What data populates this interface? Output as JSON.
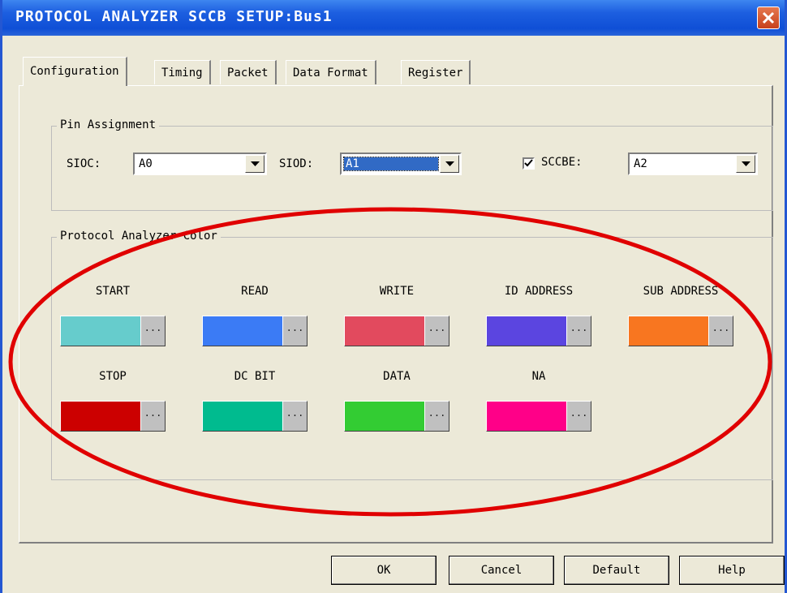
{
  "window": {
    "title": "PROTOCOL ANALYZER SCCB SETUP:Bus1"
  },
  "tabs": [
    {
      "label": "Configuration",
      "active": true
    },
    {
      "label": "Timing"
    },
    {
      "label": "Packet"
    },
    {
      "label": "Data Format"
    },
    {
      "label": "Register"
    }
  ],
  "pin_assignment": {
    "title": "Pin Assignment",
    "sioc": {
      "label": "SIOC:",
      "value": "A0"
    },
    "siod": {
      "label": "SIOD:",
      "value": "A1"
    },
    "sccbe": {
      "label": "SCCBE:",
      "checked": true,
      "value": "A2"
    }
  },
  "color_group": {
    "title": "Protocol Analyzer Color",
    "items": [
      {
        "label": "START",
        "color": "#66cccc"
      },
      {
        "label": "READ",
        "color": "#3b7bf5"
      },
      {
        "label": "WRITE",
        "color": "#e24a5e"
      },
      {
        "label": "ID ADDRESS",
        "color": "#5b45e0"
      },
      {
        "label": "SUB ADDRESS",
        "color": "#f87620"
      },
      {
        "label": "STOP",
        "color": "#cc0000"
      },
      {
        "label": "DC BIT",
        "color": "#00bb8f"
      },
      {
        "label": "DATA",
        "color": "#33cc33"
      },
      {
        "label": "NA",
        "color": "#ff0088"
      }
    ],
    "more_label": "..."
  },
  "buttons": {
    "ok": "OK",
    "cancel": "Cancel",
    "default": "Default",
    "help": "Help"
  },
  "highlight_color": "#e00000"
}
